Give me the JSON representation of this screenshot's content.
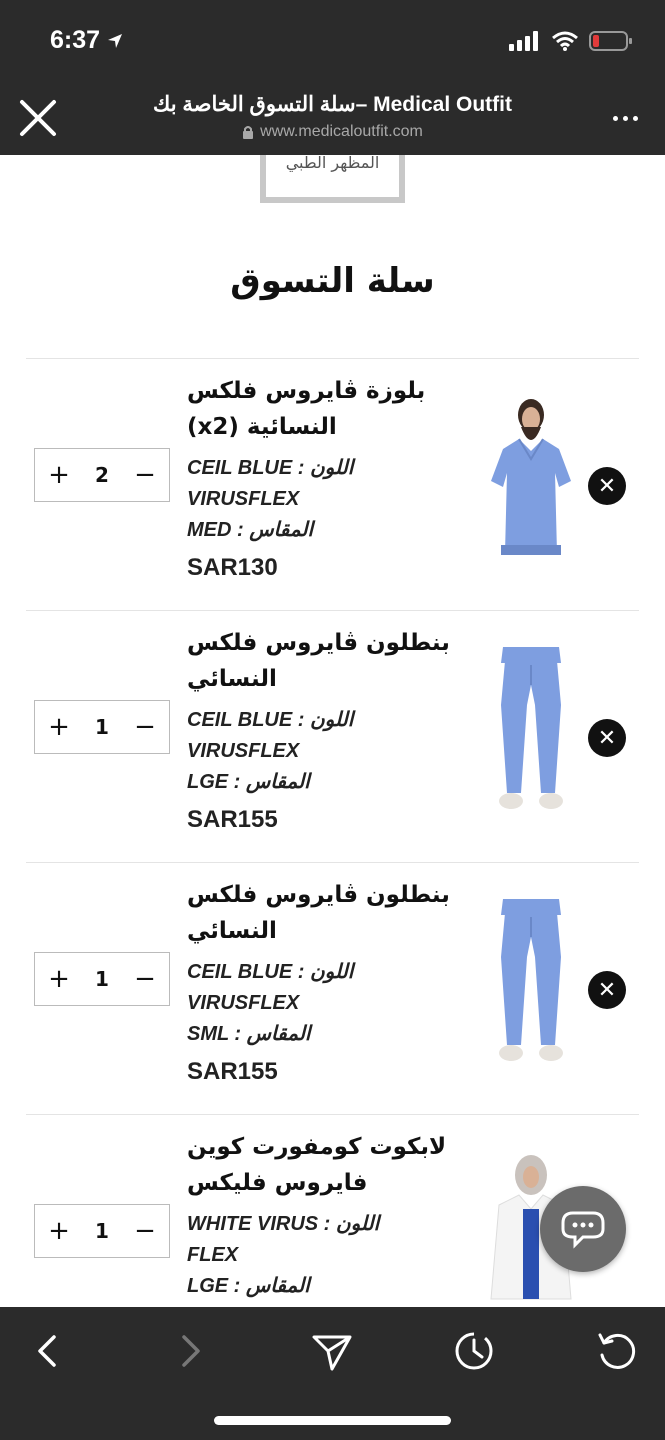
{
  "status_bar": {
    "time": "6:37"
  },
  "browser": {
    "page_title": "سلة التسوق الخاصة بك– Medical Outfit",
    "url": "www.medicaloutfit.com"
  },
  "page": {
    "logo_text": "المظهر الطبي",
    "heading": "سلة التسوق"
  },
  "cart": {
    "items": [
      {
        "name_line1": "بلوزة ڤايروس فلكس",
        "name_line2": "النسائية (x2)",
        "color_line": "CEIL BLUE : اللون",
        "color_line2": "VIRUSFLEX",
        "size_line": "MED : المقاس",
        "price": "SAR130",
        "quantity": "2"
      },
      {
        "name_line1": "بنطلون ڤايروس فلكس",
        "name_line2": "النسائي",
        "color_line": "CEIL BLUE : اللون",
        "color_line2": "VIRUSFLEX",
        "size_line": "LGE : المقاس",
        "price": "SAR155",
        "quantity": "1"
      },
      {
        "name_line1": "بنطلون ڤايروس فلكس",
        "name_line2": "النسائي",
        "color_line": "CEIL BLUE : اللون",
        "color_line2": "VIRUSFLEX",
        "size_line": "SML : المقاس",
        "price": "SAR155",
        "quantity": "1"
      },
      {
        "name_line1": "لابكوت كومفورت كوين",
        "name_line2": "فايروس فليكس",
        "color_line": "WHITE VIRUS : اللون",
        "color_line2": "FLEX",
        "size_line": "LGE : المقاس",
        "price": "",
        "quantity": "1"
      }
    ],
    "plus_symbol": "+",
    "minus_symbol": "−",
    "remove_symbol": "✕"
  },
  "colors": {
    "chrome_bg": "#2b2b2b",
    "scrub_blue": "#7e9ee0",
    "chat_gray": "#6b6b6b"
  },
  "icons": [
    "location-arrow-icon",
    "signal-icon",
    "wifi-icon",
    "battery-icon",
    "close-icon",
    "lock-icon",
    "more-icon",
    "chat-icon",
    "back-icon",
    "forward-icon",
    "share-icon",
    "history-icon",
    "reload-icon"
  ]
}
